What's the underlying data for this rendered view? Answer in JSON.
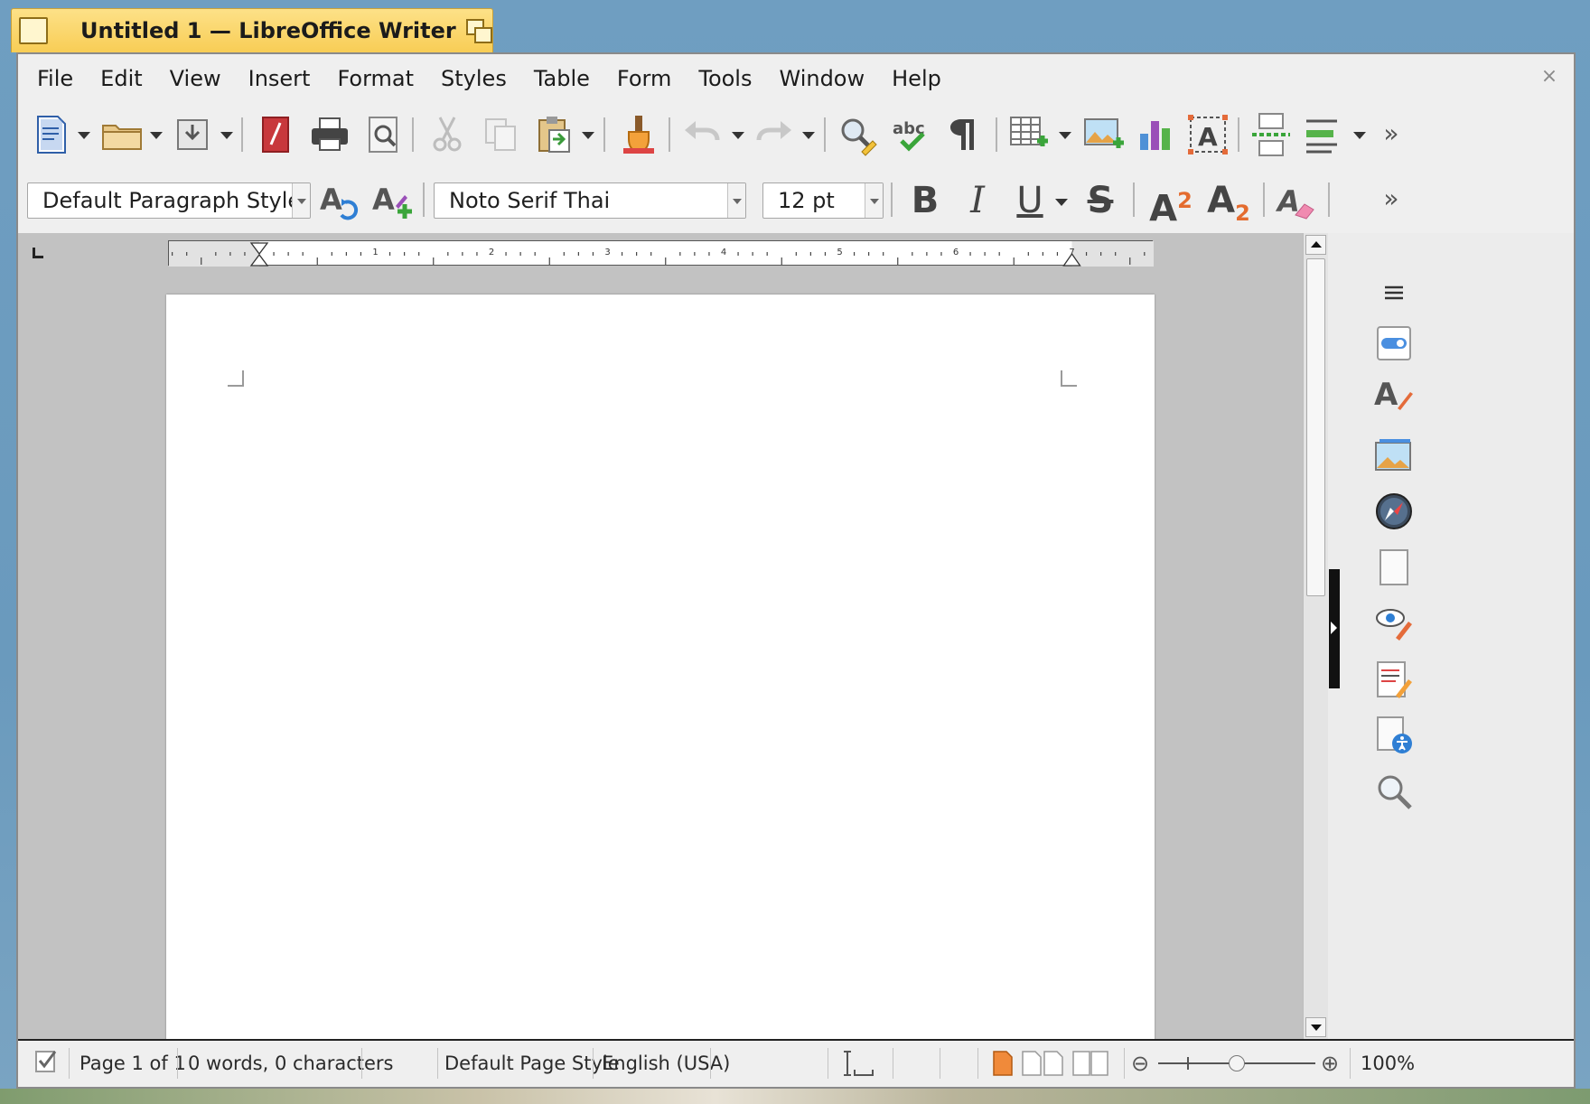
{
  "window": {
    "title": "Untitled 1 — LibreOffice Writer",
    "accent": "#f8cd55"
  },
  "menubar": {
    "items": [
      "File",
      "Edit",
      "View",
      "Insert",
      "Format",
      "Styles",
      "Table",
      "Form",
      "Tools",
      "Window",
      "Help"
    ],
    "close_glyph": "×"
  },
  "standard_toolbar": {
    "icons": [
      "new-document-icon",
      "open-folder-icon",
      "save-icon",
      "export-pdf-icon",
      "print-icon",
      "print-preview-icon",
      "cut-icon",
      "copy-icon",
      "paste-icon",
      "clone-formatting-icon",
      "undo-icon",
      "redo-icon",
      "find-replace-icon",
      "spellcheck-icon",
      "formatting-marks-icon",
      "insert-table-icon",
      "insert-image-icon",
      "insert-chart-icon",
      "insert-textbox-icon",
      "insert-page-break-icon",
      "insert-field-icon"
    ],
    "overflow_glyph": "»"
  },
  "formatting_toolbar": {
    "paragraph_style": "Default Paragraph Style",
    "font_name": "Noto Serif Thai",
    "font_size": "12 pt",
    "bold_label": "B",
    "italic_label": "I",
    "underline_label": "U",
    "strike_label": "S",
    "super_label": "A",
    "super_mark": "2",
    "sub_label": "A",
    "sub_mark": "2",
    "overflow_glyph": "»"
  },
  "ruler": {
    "numbers": [
      "1",
      "2",
      "3",
      "4",
      "5",
      "6",
      "7"
    ]
  },
  "sidebar": {
    "icons": [
      "sidebar-menu-icon",
      "properties-icon",
      "styles-icon",
      "gallery-icon",
      "navigator-icon",
      "page-icon",
      "style-inspector-icon",
      "manage-changes-icon",
      "accessibility-check-icon",
      "find-icon"
    ]
  },
  "statusbar": {
    "page": "Page 1 of 1",
    "words": "0 words, 0 characters",
    "page_style": "Default Page Style",
    "language": "English (USA)",
    "zoom": "100%",
    "zoom_minus": "⊖",
    "zoom_plus": "⊕"
  }
}
